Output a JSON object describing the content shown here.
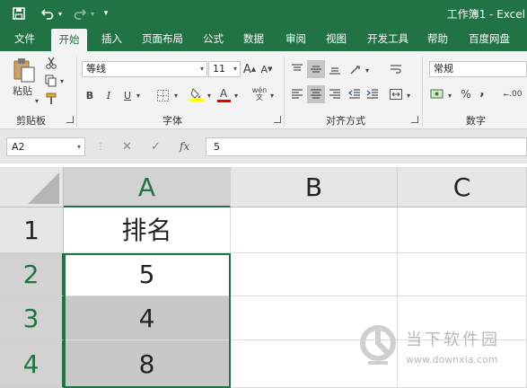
{
  "window": {
    "title": "工作簿1 - Excel"
  },
  "quick_access": {
    "save_icon": "save-icon",
    "undo_icon": "undo-icon",
    "redo_icon": "redo-icon",
    "customize_icon": "customize-icon"
  },
  "tabs": [
    {
      "label": "文件"
    },
    {
      "label": "开始"
    },
    {
      "label": "插入"
    },
    {
      "label": "页面布局"
    },
    {
      "label": "公式"
    },
    {
      "label": "数据"
    },
    {
      "label": "审阅"
    },
    {
      "label": "视图"
    },
    {
      "label": "开发工具"
    },
    {
      "label": "帮助"
    },
    {
      "label": "百度网盘"
    }
  ],
  "active_tab": "开始",
  "ribbon": {
    "clipboard": {
      "label": "剪贴板",
      "paste_label": "粘贴"
    },
    "font": {
      "label": "字体",
      "font_name": "等线",
      "font_size": "11",
      "bold": "B",
      "italic": "I",
      "underline": "U",
      "grow": "A",
      "shrink": "A",
      "font_color_letter": "A",
      "phonetic": "wén"
    },
    "alignment": {
      "label": "对齐方式"
    },
    "number": {
      "label": "数字",
      "format": "常规",
      "percent": "%",
      "comma": ",",
      "decimal": ".00"
    }
  },
  "formula_bar": {
    "name_box": "A2",
    "fx_label": "fx",
    "value": "5"
  },
  "grid": {
    "columns": [
      "A",
      "B",
      "C"
    ],
    "rows": [
      {
        "num": "1",
        "a": "排名"
      },
      {
        "num": "2",
        "a": "5"
      },
      {
        "num": "3",
        "a": "4"
      },
      {
        "num": "4",
        "a": "8"
      }
    ]
  },
  "colors": {
    "excel_green": "#217346",
    "selection_gray": "#c8c8c8"
  },
  "watermark": {
    "name": "当下软件园",
    "url": "www.downxia.com"
  }
}
